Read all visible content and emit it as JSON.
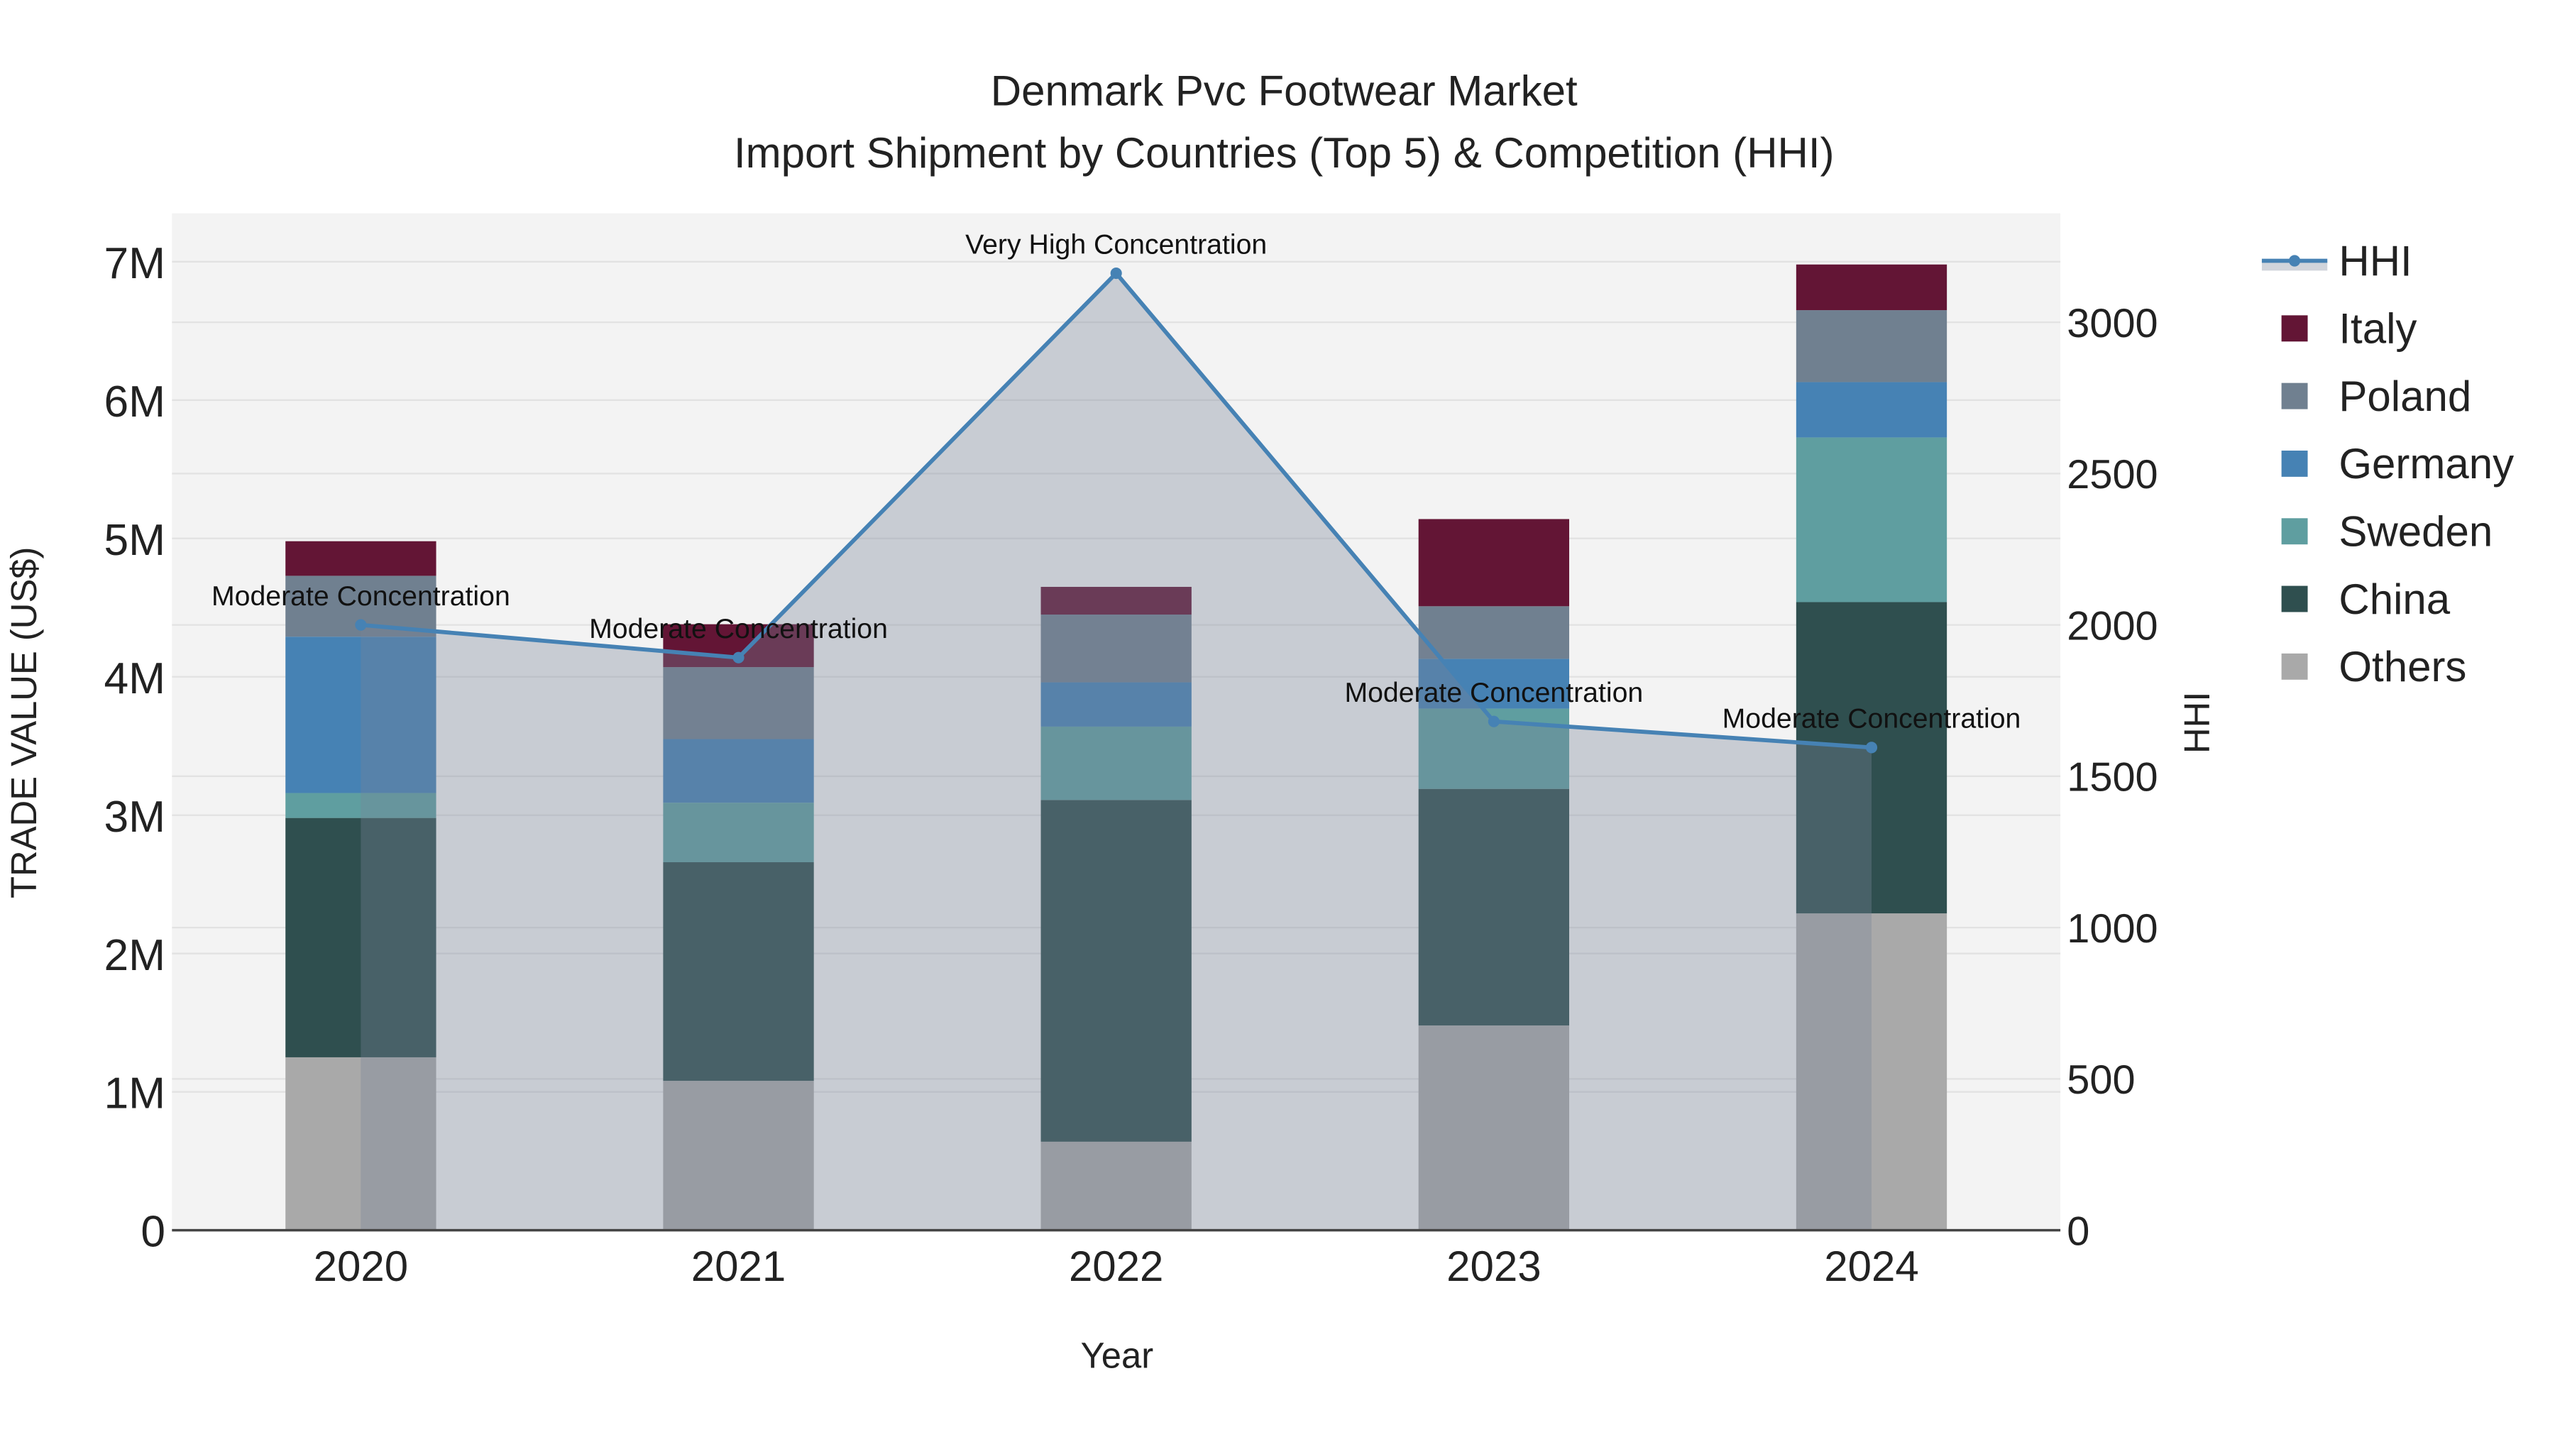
{
  "chart_data": {
    "type": "bar",
    "barmode": "stack",
    "title": "Denmark Pvc Footwear Market",
    "subtitle": "Import Shipment by Countries (Top 5) & Competition (HHI)",
    "xlabel": "Year",
    "ylabel": "TRADE VALUE (US$)",
    "y2label": "HHI",
    "categories": [
      "2020",
      "2021",
      "2022",
      "2023",
      "2024"
    ],
    "ylim": [
      0,
      7350000
    ],
    "y_ticks": [
      0,
      1000000,
      2000000,
      3000000,
      4000000,
      5000000,
      6000000,
      7000000
    ],
    "y_tick_labels": [
      "0",
      "1M",
      "2M",
      "3M",
      "4M",
      "5M",
      "6M",
      "7M"
    ],
    "y2lim": [
      0,
      3360
    ],
    "y2_ticks": [
      0,
      500,
      1000,
      1500,
      2000,
      2500,
      3000
    ],
    "y2_tick_labels": [
      "0",
      "500",
      "1000",
      "1500",
      "2000",
      "2500",
      "3000"
    ],
    "series": [
      {
        "name": "Others",
        "color": "#A9A9A9",
        "values": [
          1250000,
          1080000,
          640000,
          1480000,
          2290000
        ]
      },
      {
        "name": "China",
        "color": "#2F4F4F",
        "values": [
          1730000,
          1580000,
          2470000,
          1710000,
          2250000
        ]
      },
      {
        "name": "Sweden",
        "color": "#5F9EA0",
        "values": [
          180000,
          430000,
          530000,
          580000,
          1190000
        ]
      },
      {
        "name": "Germany",
        "color": "#4682B4",
        "values": [
          1130000,
          460000,
          320000,
          360000,
          400000
        ]
      },
      {
        "name": "Poland",
        "color": "#708090",
        "values": [
          440000,
          520000,
          490000,
          380000,
          520000
        ]
      },
      {
        "name": "Italy",
        "color": "#631535",
        "values": [
          250000,
          310000,
          200000,
          630000,
          330000
        ]
      }
    ],
    "hhi": {
      "name": "HHI",
      "color": "#4682B4",
      "values": [
        2000,
        1892,
        3162,
        1681,
        1595
      ],
      "annotations": [
        "Moderate Concentration",
        "Moderate Concentration",
        "Very High Concentration",
        "Moderate Concentration",
        "Moderate Concentration"
      ]
    },
    "legend_order": [
      "HHI",
      "Italy",
      "Poland",
      "Germany",
      "Sweden",
      "China",
      "Others"
    ],
    "legend_position": "right",
    "grid": true
  }
}
